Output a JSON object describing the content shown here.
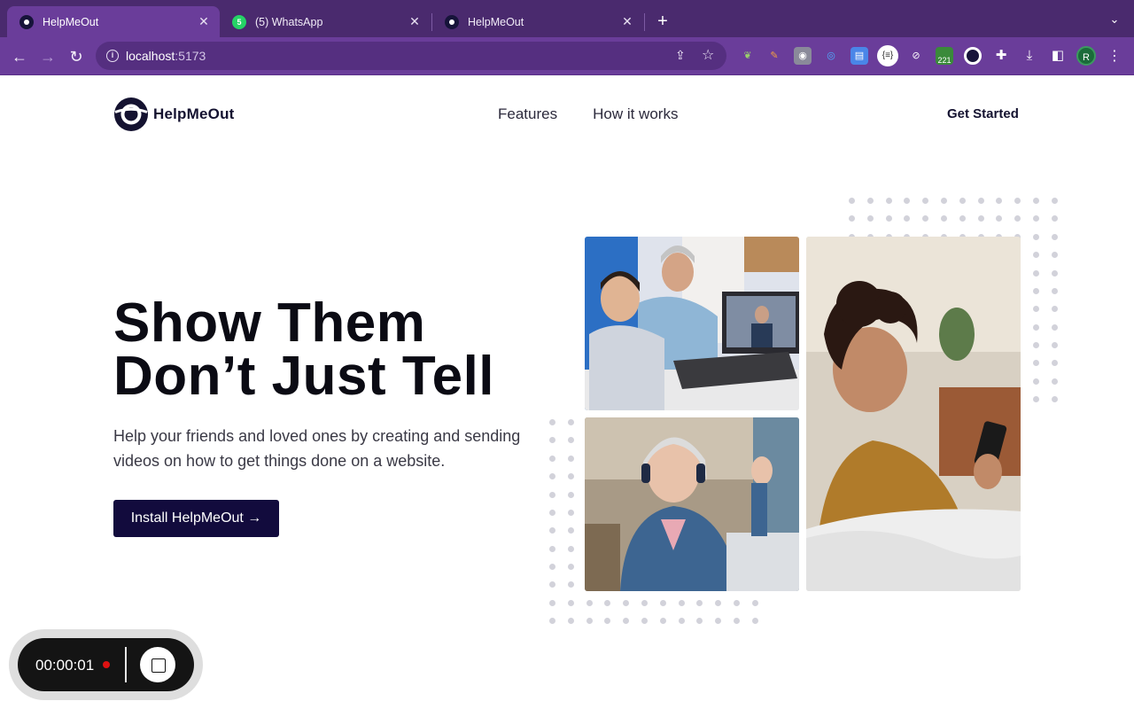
{
  "browser": {
    "tabs": [
      {
        "title": "HelpMeOut",
        "icon": "helpmeout-favicon",
        "active": true
      },
      {
        "title": "(5) WhatsApp",
        "icon": "whatsapp-favicon",
        "badge": "5",
        "active": false
      },
      {
        "title": "HelpMeOut",
        "icon": "helpmeout-favicon",
        "active": false
      }
    ],
    "url_host": "localhost",
    "url_port": ":5173",
    "profile_initial": "R",
    "extension_badge": "221"
  },
  "site": {
    "logo_text": "HelpMeOut",
    "nav": [
      "Features",
      "How it works"
    ],
    "get_started": "Get Started",
    "hero_title_line1": "Show Them",
    "hero_title_line2": "Don’t Just Tell",
    "hero_subtitle": "Help your friends and loved ones by creating and sending videos on how to get things done on a website.",
    "cta_label": "Install HelpMeOut →"
  },
  "recorder": {
    "time": "00:00:01"
  },
  "colors": {
    "brand_dark": "#120b3d",
    "chrome_purple": "#6a3d9a",
    "tab_bar": "#4a2a6e",
    "record_red": "#dd1111"
  }
}
